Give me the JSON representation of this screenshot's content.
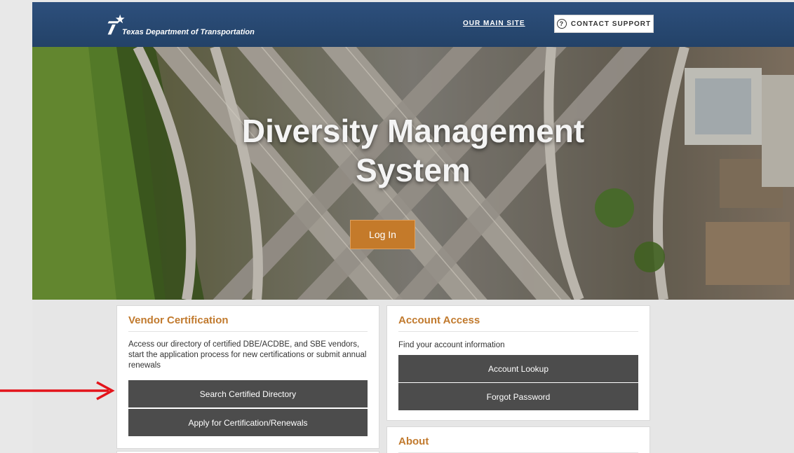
{
  "header": {
    "org_name": "Texas Department of Transportation",
    "main_site_link": "OUR MAIN SITE",
    "contact_support": "CONTACT SUPPORT",
    "support_icon_glyph": "?"
  },
  "hero": {
    "title_line1": "Diversity Management",
    "title_line2": "System",
    "login_button": "Log In"
  },
  "vendor_card": {
    "title": "Vendor Certification",
    "description": "Access our directory of certified DBE/ACDBE, and SBE vendors, start the application process for new certifications or submit annual renewals",
    "buttons": [
      "Search Certified Directory",
      "Apply for Certification/Renewals"
    ]
  },
  "account_card": {
    "title": "Account Access",
    "description": "Find your account information",
    "buttons": [
      "Account Lookup",
      "Forgot Password"
    ]
  },
  "about_card": {
    "title": "About"
  },
  "annotation": {
    "arrow_color": "#e3141b",
    "arrow_target": "Search Certified Directory"
  },
  "colors": {
    "header_blue": "#234268",
    "accent_orange": "#c47a2a",
    "button_dark": "#4c4c4c"
  }
}
